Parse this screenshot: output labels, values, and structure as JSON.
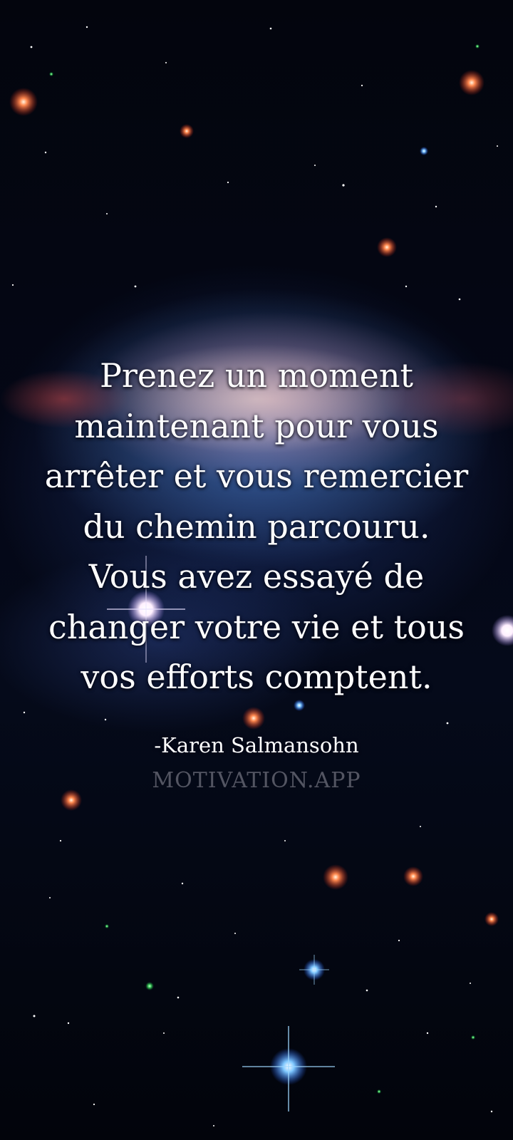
{
  "quote": {
    "lines": [
      "Prenez un moment",
      "maintenant pour vous",
      "arrêter et vous remercier",
      "du chemin parcouru.",
      " Vous avez essayé de",
      "changer votre vie et tous",
      "vos efforts comptent."
    ],
    "author": "-Karen Salmansohn"
  },
  "watermark": {
    "text": "MOTIVATION.APP"
  }
}
